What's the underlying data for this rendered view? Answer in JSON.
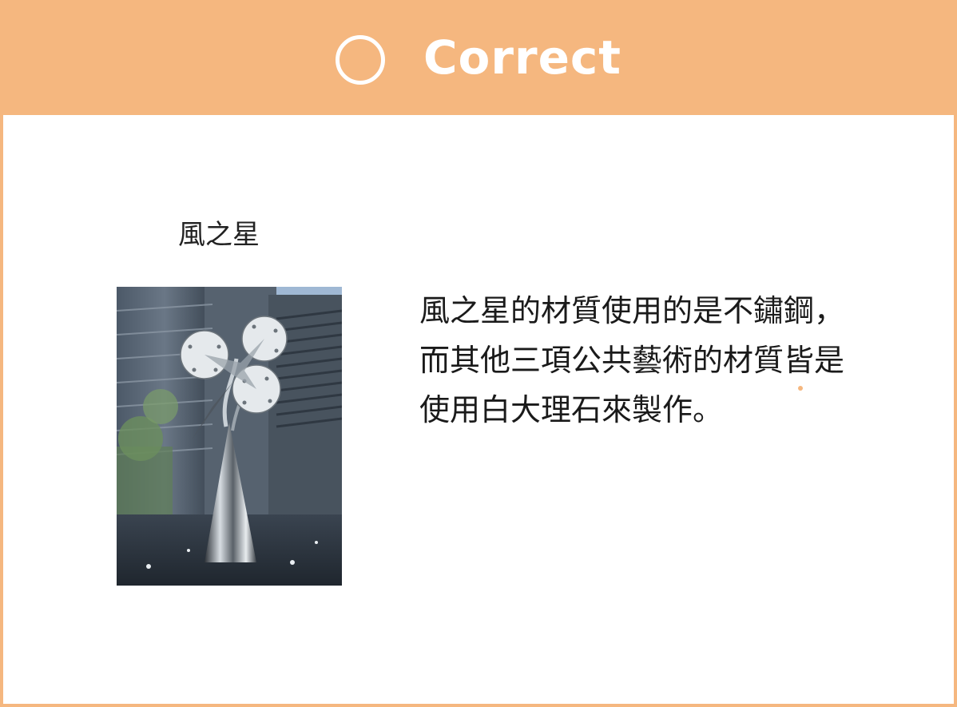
{
  "header": {
    "title": "Correct",
    "icon": "circle-icon",
    "background_color": "#f5b77f",
    "text_color": "#ffffff"
  },
  "artwork": {
    "caption": "風之星",
    "image": "sculpture-photo"
  },
  "explanation": {
    "lines": [
      "風之星的材質使用的是不鏽鋼，",
      "而其他三項公共藝術的材質皆是",
      "使用白大理石來製作。"
    ]
  },
  "accent_color": "#f5b77f"
}
